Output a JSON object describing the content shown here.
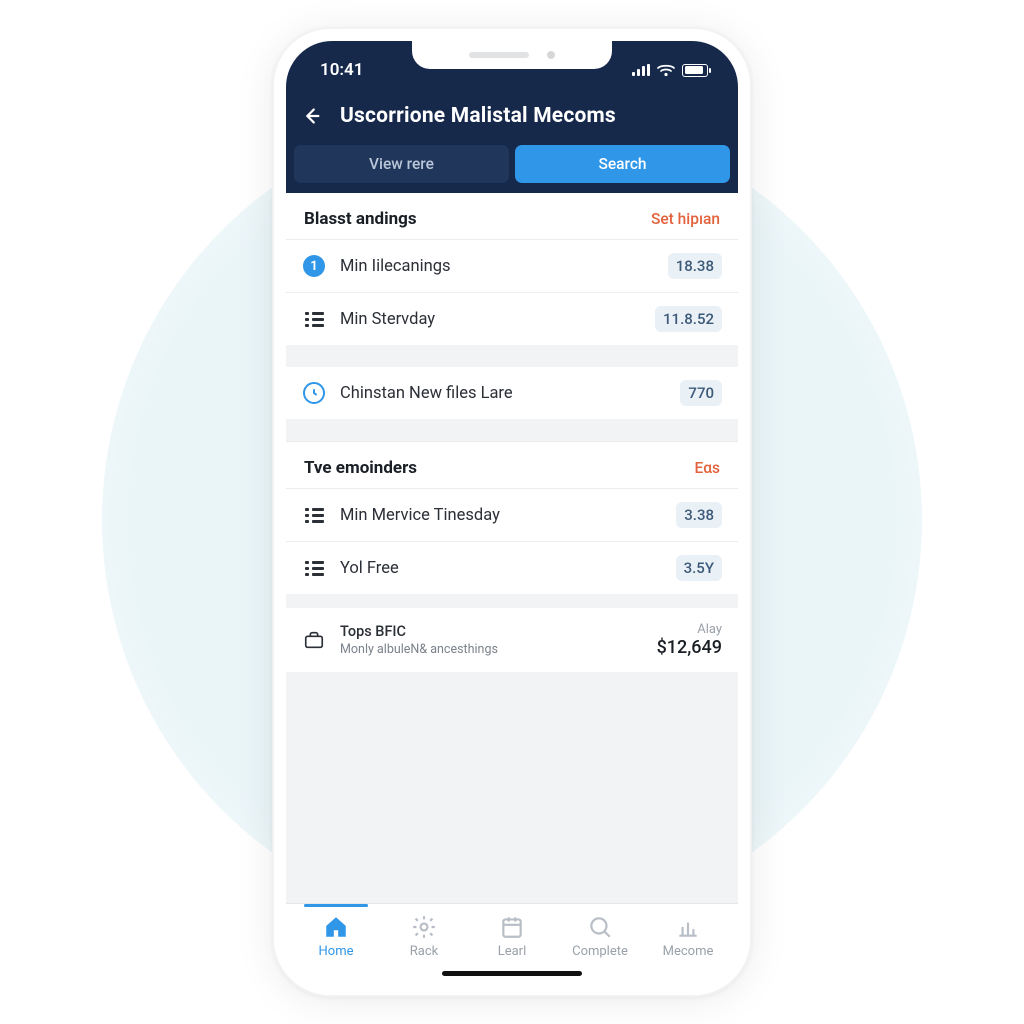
{
  "status_bar": {
    "time": "10:41"
  },
  "header": {
    "title": "Uscorrione Malistal Mecoms",
    "tabs": {
      "view": "View rere",
      "search": "Search"
    }
  },
  "section1": {
    "title": "Blasst andings",
    "action": "Set hipıan",
    "rows": [
      {
        "label": "Min Iilecanings",
        "value": "18.38"
      },
      {
        "label": "Min Sterνday",
        "value": "11.8.52"
      }
    ],
    "info_row": {
      "label": "Chinstan New files Lare",
      "value": "770"
    }
  },
  "section2": {
    "title": "Tve emoinders",
    "action": "Eαs",
    "rows": [
      {
        "label": "Min Mervice Tinesday",
        "value": "3.38"
      },
      {
        "label": "Yol Free",
        "value": "3.5Y"
      }
    ],
    "summary": {
      "title": "Tops BFIC",
      "sub": "Monly albuleN& ancesthings",
      "note": "Alay",
      "amount": "$12,649"
    }
  },
  "nav": {
    "home": "Home",
    "rack": "Rack",
    "learl": "Learl",
    "complete": "Complete",
    "mecome": "Mecome"
  }
}
